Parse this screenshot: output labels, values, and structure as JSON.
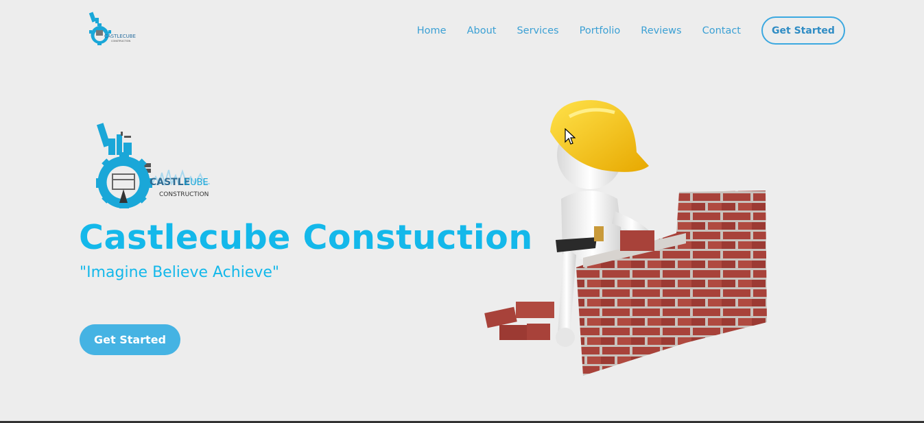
{
  "header": {
    "logo": {
      "icon": "castlecube-logo-icon",
      "text_main": "CASTLECUBE",
      "text_sub": "CONSTRUCTION"
    },
    "nav": [
      {
        "label": "Home"
      },
      {
        "label": "About"
      },
      {
        "label": "Services"
      },
      {
        "label": "Portfolio"
      },
      {
        "label": "Reviews"
      },
      {
        "label": "Contact"
      }
    ],
    "cta_label": "Get Started"
  },
  "hero": {
    "logo": {
      "icon": "castlecube-logo-icon",
      "text_castle": "CASTLE",
      "text_cube": "CUBE",
      "text_sub": "CONSTRUCTION"
    },
    "title": "Castlecube Constuction",
    "tagline": "\"Imagine Believe Achieve\"",
    "cta_label": "Get Started",
    "illustration": "bricklayer-figure-icon"
  },
  "colors": {
    "background": "#ededed",
    "accent": "#14b8ea",
    "nav_text": "#3ba0d4",
    "button": "#45b3e3",
    "helmet": "#f7c600",
    "brick": "#a8423a"
  }
}
